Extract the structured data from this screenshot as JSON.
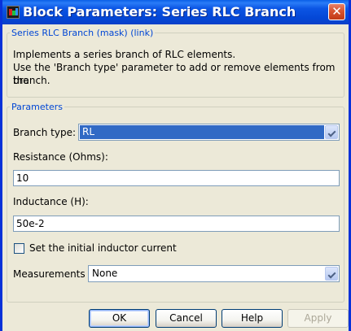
{
  "window": {
    "title": "Block Parameters: Series RLC Branch"
  },
  "mask": {
    "legend": "Series RLC Branch (mask) (link)",
    "description_lines": [
      "Implements a series branch of RLC elements.",
      "Use the 'Branch type' parameter to add or remove elements from the",
      "branch."
    ]
  },
  "parameters": {
    "legend": "Parameters",
    "branch_type_label": "Branch type:",
    "branch_type_value": "RL",
    "resistance_label": "Resistance (Ohms):",
    "resistance_value": "10",
    "inductance_label": "Inductance (H):",
    "inductance_value": "50e-2",
    "initial_current_label": "Set the initial inductor current",
    "initial_current_checked": false,
    "measurements_label": "Measurements",
    "measurements_value": "None"
  },
  "buttons": {
    "ok": "OK",
    "cancel": "Cancel",
    "help": "Help",
    "apply": "Apply"
  },
  "icons": {
    "app": "simulink-block-icon",
    "close": "close-icon",
    "dropdown": "chevron-down-icon"
  },
  "colors": {
    "titlebar": "#0a5fe8",
    "legend_text": "#0046d5",
    "selection": "#316ac5",
    "close_button": "#d8542f",
    "dialog_background": "#ece9d8"
  }
}
